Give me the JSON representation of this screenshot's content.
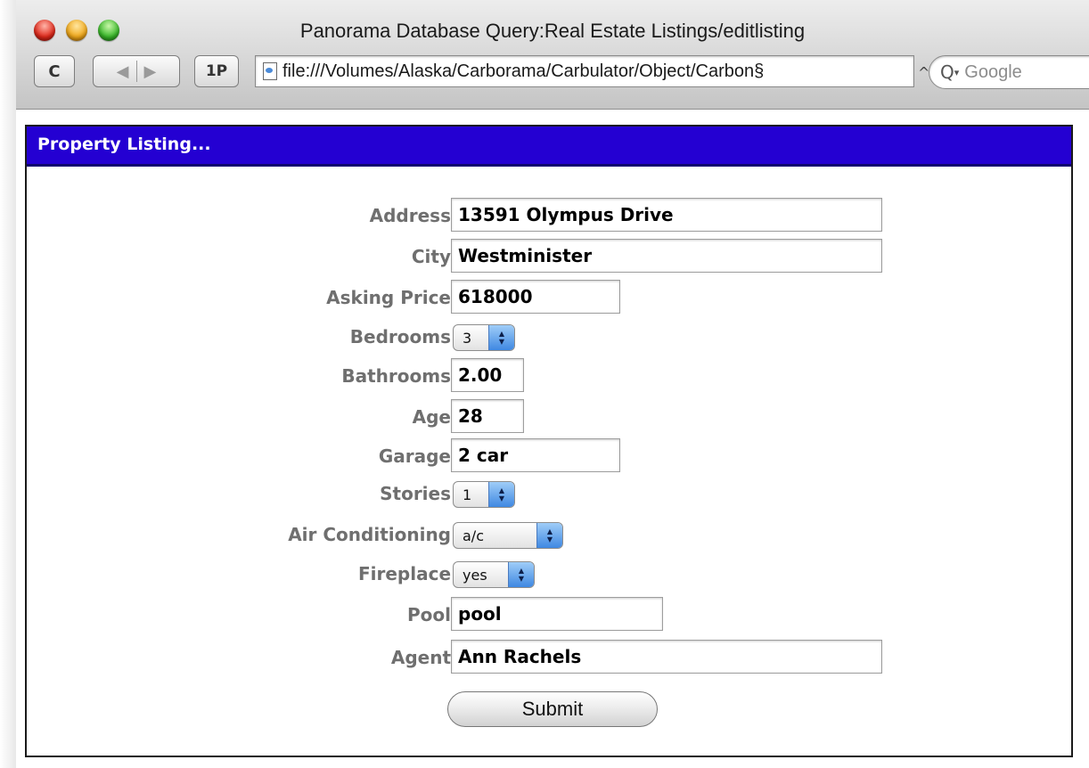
{
  "window": {
    "title": "Panorama Database Query:Real Estate Listings/editlisting"
  },
  "toolbar": {
    "reload_label": "C",
    "back_glyph": "◀",
    "forward_glyph": "▶",
    "onepassword_label": "1P",
    "url": "file:///Volumes/Alaska/Carborama/Carbulator/Object/Carbon§",
    "search_placeholder": "Google"
  },
  "panel": {
    "title": "Property Listing..."
  },
  "form": {
    "address": {
      "label": "Address:",
      "value": "13591 Olympus Drive"
    },
    "city": {
      "label": "City:",
      "value": "Westminister"
    },
    "asking_price": {
      "label": "Asking Price:",
      "value": "618000"
    },
    "bedrooms": {
      "label": "Bedrooms:",
      "value": "3"
    },
    "bathrooms": {
      "label": "Bathrooms:",
      "value": "2.00"
    },
    "age": {
      "label": "Age:",
      "value": "28"
    },
    "garage": {
      "label": "Garage:",
      "value": "2 car"
    },
    "stories": {
      "label": "Stories:",
      "value": "1"
    },
    "air_conditioning": {
      "label": "Air Conditioning:",
      "value": "a/c"
    },
    "fireplace": {
      "label": "Fireplace:",
      "value": "yes"
    },
    "pool": {
      "label": "Pool:",
      "value": "pool"
    },
    "agent": {
      "label": "Agent:",
      "value": "Ann Rachels"
    },
    "submit_label": "Submit"
  },
  "colors": {
    "header_bg": "#2400d2",
    "label_text": "#6f6f6f",
    "popup_accent": "#3f88e2"
  },
  "icons": [
    "close-icon",
    "minimize-icon",
    "zoom-icon",
    "reload-icon",
    "back-icon",
    "forward-icon",
    "document-icon",
    "search-icon"
  ]
}
